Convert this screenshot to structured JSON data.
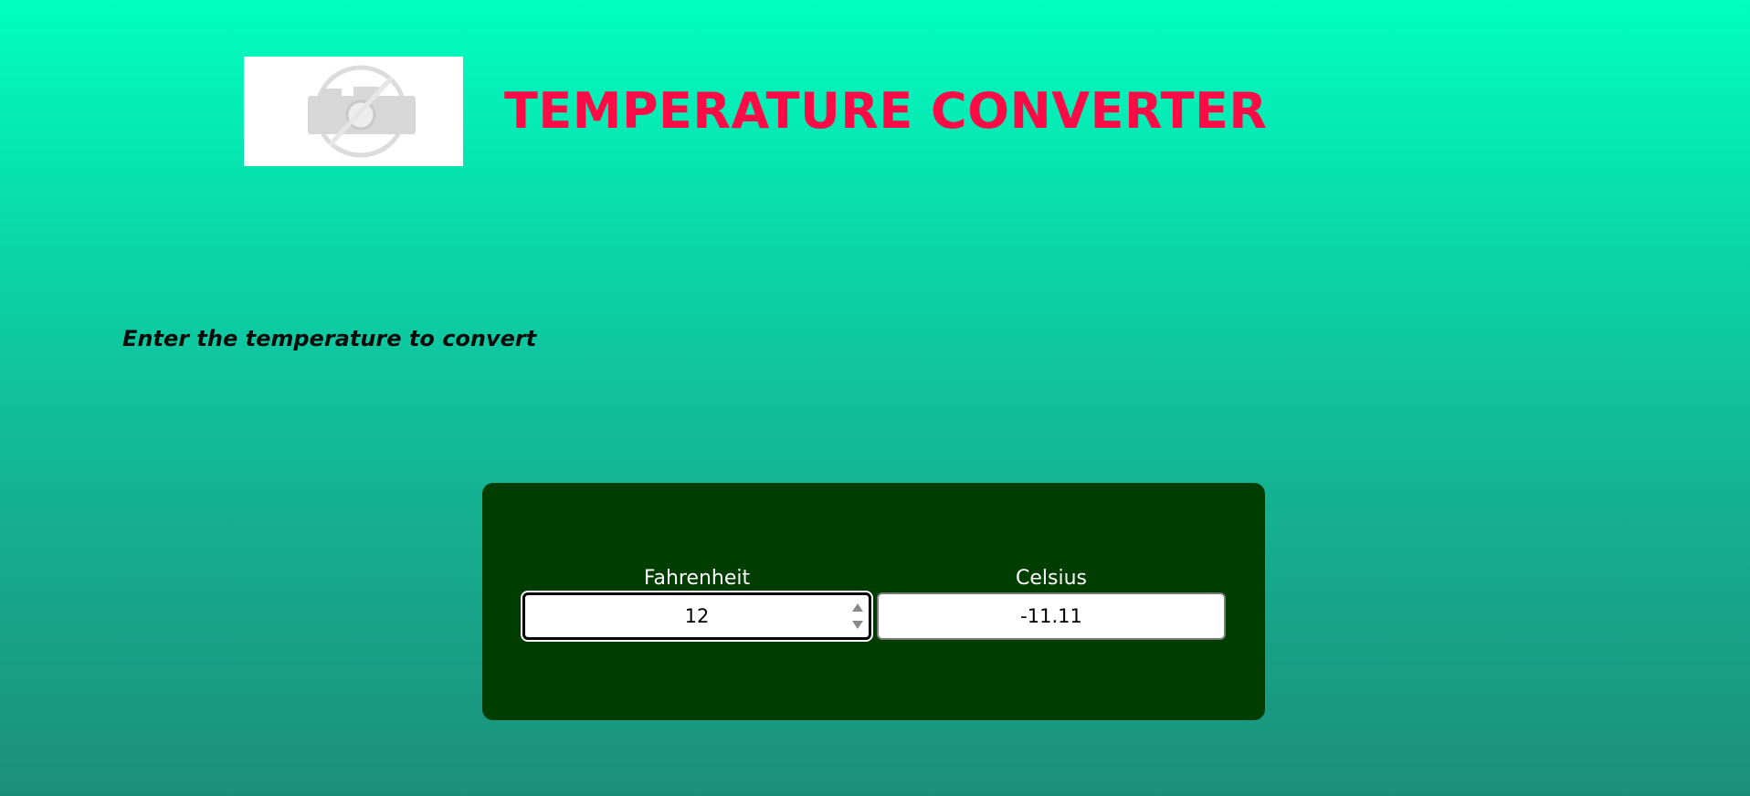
{
  "header": {
    "logo_icon": "broken-image-camera-icon",
    "title": "TEMPERATURE CONVERTER"
  },
  "instruction": "Enter the temperature to convert",
  "converter": {
    "fahrenheit": {
      "label": "Fahrenheit",
      "value": "12"
    },
    "celsius": {
      "label": "Celsius",
      "value": "-11.11"
    }
  },
  "colors": {
    "title": "#fc0b47",
    "panel": "#003d00",
    "background_top": "#00ffc1",
    "background_bottom": "#1c8f7a"
  }
}
